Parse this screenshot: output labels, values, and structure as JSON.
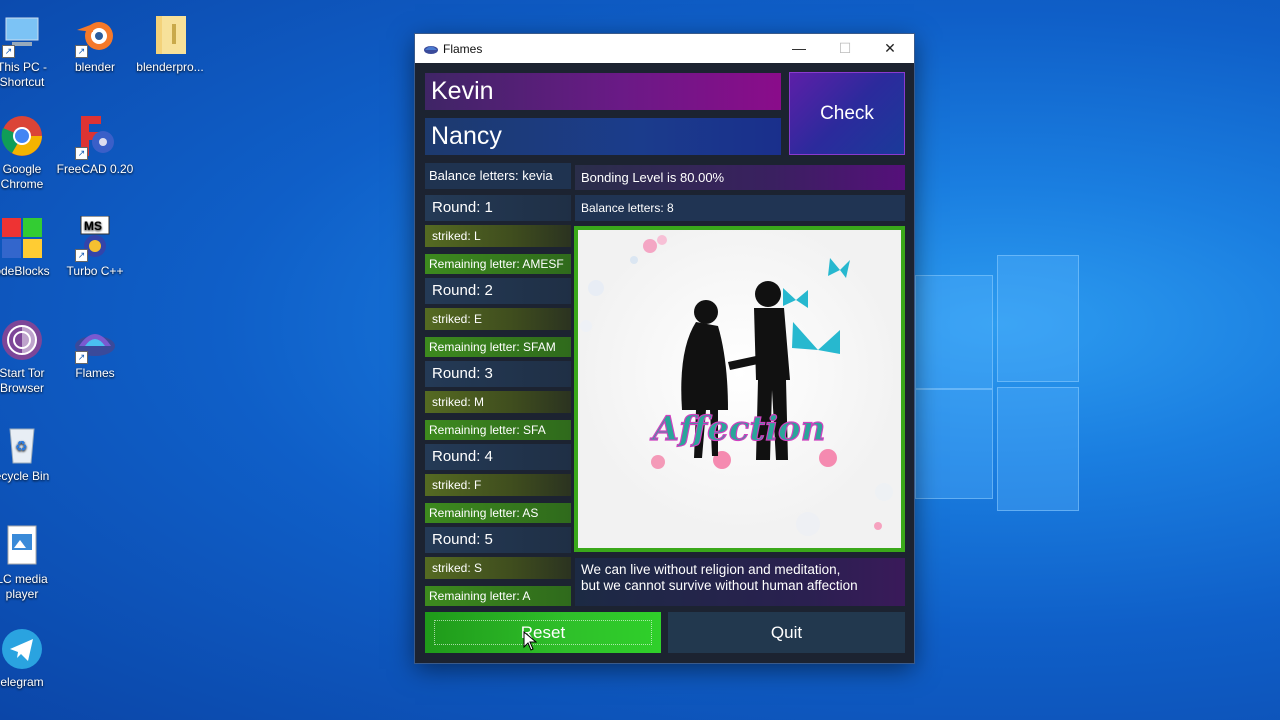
{
  "desktop_icons": [
    {
      "label": "This PC - Shortcut",
      "icon": "this-pc-icon"
    },
    {
      "label": "blender",
      "icon": "blender-icon"
    },
    {
      "label": "blenderpro...",
      "icon": "folder-icon"
    },
    {
      "label": "Google Chrome",
      "icon": "chrome-icon"
    },
    {
      "label": "FreeCAD 0.20",
      "icon": "freecad-icon"
    },
    {
      "label": "odeBlocks",
      "icon": "codeblocks-icon"
    },
    {
      "label": "Turbo C++",
      "icon": "turbo-cpp-icon"
    },
    {
      "label": "Start Tor Browser",
      "icon": "tor-browser-icon"
    },
    {
      "label": "Flames",
      "icon": "flames-app-icon"
    },
    {
      "label": "ecycle Bin",
      "icon": "recycle-bin-icon"
    },
    {
      "label": "LC media player",
      "icon": "vlc-icon"
    },
    {
      "label": "elegram",
      "icon": "telegram-icon"
    }
  ],
  "window": {
    "title": "Flames",
    "minimize": "—",
    "maximize": "☐",
    "close": "✕"
  },
  "app": {
    "name1": "Kevin",
    "name2": "Nancy",
    "check_label": "Check",
    "balance_letters_left": "Balance letters: kevia",
    "bonding_level": "Bonding Level is 80.00%",
    "balance_letters_right": "Balance letters: 8",
    "rounds": [
      {
        "round": "Round: 1",
        "striked": "striked: L",
        "remaining": "Remaining letter: AMESF"
      },
      {
        "round": "Round: 2",
        "striked": "striked: E",
        "remaining": "Remaining letter: SFAM"
      },
      {
        "round": "Round: 3",
        "striked": "striked: M",
        "remaining": "Remaining letter: SFA"
      },
      {
        "round": "Round: 4",
        "striked": "striked: F",
        "remaining": "Remaining letter: AS"
      },
      {
        "round": "Round: 5",
        "striked": "striked: S",
        "remaining": "Remaining letter: A"
      }
    ],
    "result_image_text": "Affection",
    "quote_line1": "We can live without religion and meditation,",
    "quote_line2": "but we cannot survive without human affection",
    "reset_label": "Reset",
    "quit_label": "Quit"
  },
  "colors": {
    "window_bg": "#1c2331",
    "reset_green": "#2fc02a",
    "frame_green": "#3aa81a",
    "desktop_blue": "#1a7ee0"
  }
}
